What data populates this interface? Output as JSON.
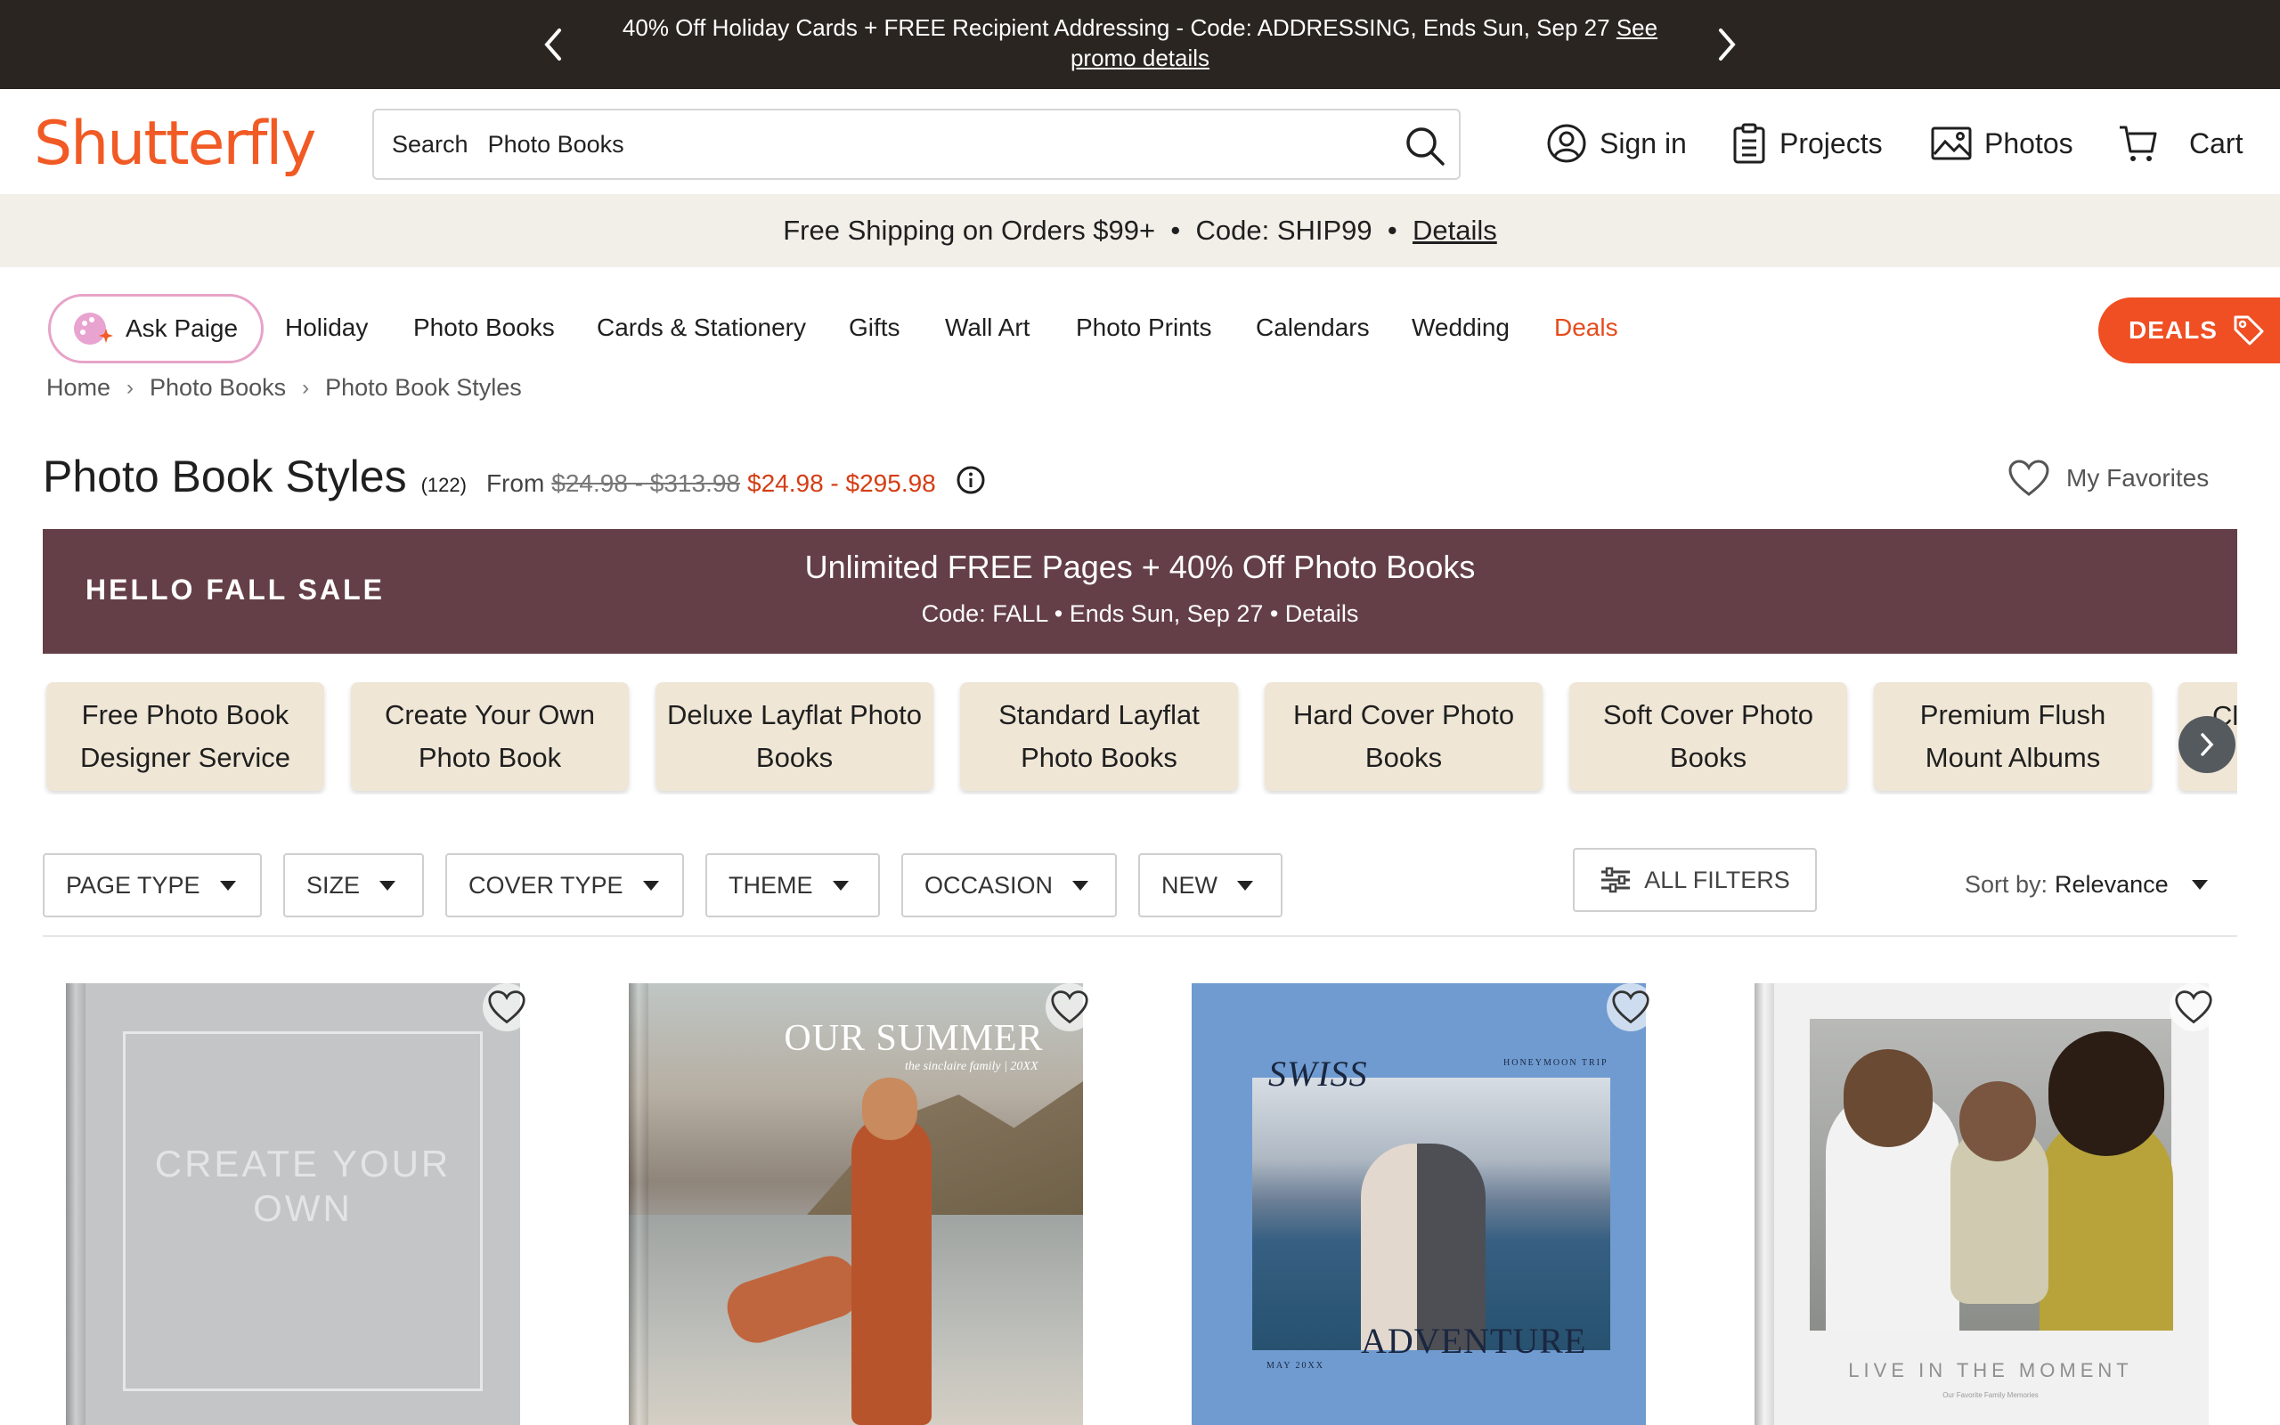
{
  "promo": {
    "message": "40% Off Holiday Cards + FREE Recipient Addressing - Code: ADDRESSING, Ends Sun, Sep 27",
    "link": "See promo details"
  },
  "header": {
    "logo": "Shutterfly",
    "search_label": "Search",
    "search_value": "Photo Books",
    "nav": {
      "sign_in": "Sign in",
      "projects": "Projects",
      "photos": "Photos",
      "cart": "Cart"
    }
  },
  "shipping": {
    "text1": "Free Shipping on Orders $99+",
    "text2": "Code: SHIP99",
    "link": "Details"
  },
  "categories": {
    "ask_paige": "Ask Paige",
    "items": [
      "Holiday",
      "Photo Books",
      "Cards & Stationery",
      "Gifts",
      "Wall Art",
      "Photo Prints",
      "Calendars",
      "Wedding",
      "Deals"
    ],
    "deals_button": "DEALS"
  },
  "breadcrumb": [
    "Home",
    "Photo Books",
    "Photo Book Styles"
  ],
  "title": {
    "heading": "Photo Book Styles",
    "count": "(122)",
    "from": "From",
    "original_price": "$24.98 - $313.98",
    "sale_price": "$24.98 - $295.98",
    "favorites": "My Favorites"
  },
  "sale_banner": {
    "label": "HELLO FALL SALE",
    "headline": "Unlimited FREE Pages + 40% Off Photo Books",
    "sub": "Code: FALL  •  Ends Sun, Sep 27  •  Details"
  },
  "tiles": [
    "Free Photo Book Designer Service",
    "Create Your Own Photo Book",
    "Deluxe Layflat Photo Books",
    "Standard Layflat Photo Books",
    "Hard Cover Photo Books",
    "Soft Cover Photo Books",
    "Premium Flush Mount Albums",
    "Cl"
  ],
  "filters": [
    "PAGE TYPE",
    "SIZE",
    "COVER TYPE",
    "THEME",
    "OCCASION",
    "NEW"
  ],
  "all_filters": "ALL FILTERS",
  "sort": {
    "label": "Sort by:",
    "value": "Relevance"
  },
  "products": {
    "p1": {
      "cover_text": "CREATE YOUR OWN"
    },
    "p2": {
      "title": "OUR SUMMER",
      "subtitle": "the sinclaire family | 20XX"
    },
    "p3": {
      "title_top": "SWISS",
      "title_bottom": "ADVENTURE",
      "tag": "HONEYMOON TRIP",
      "date": "MAY 20XX"
    },
    "p4": {
      "title": "LIVE IN THE MOMENT",
      "subtitle": "Our Favorite Family Memories"
    }
  },
  "colors": {
    "brand_orange": "#f15a24",
    "promo_bar": "#2a2520",
    "sale_banner": "#643f47",
    "sale_price": "#d43d14",
    "tile_bg": "#efe6d6",
    "ship_bar": "#f2efe9"
  }
}
